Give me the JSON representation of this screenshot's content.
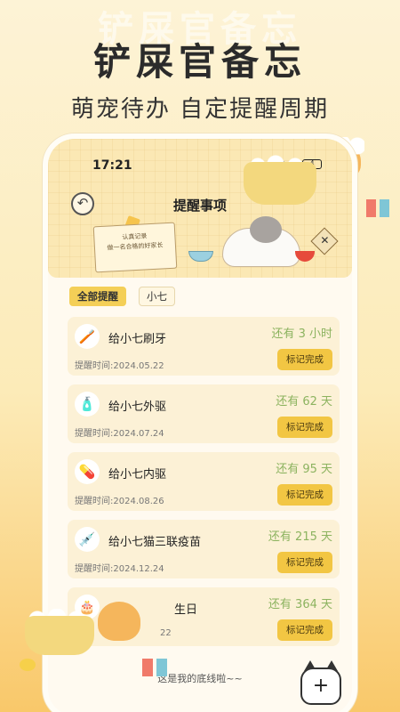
{
  "promo": {
    "headline": "铲屎官备忘",
    "ghost_text": "铲屎官备忘",
    "subtitle": "萌宠待办 自定提醒周期"
  },
  "status_bar": {
    "time": "17:21",
    "battery": "4"
  },
  "header": {
    "title": "提醒事项",
    "note_line1": "认真记录",
    "note_line2": "做一名合格的好家长"
  },
  "filters": [
    {
      "label": "全部提醒",
      "active": true
    },
    {
      "label": "小七",
      "active": false
    }
  ],
  "reminders": [
    {
      "title": "给小七刷牙",
      "date": "提醒时间:2024.05.22",
      "remaining": "还有 3 小时",
      "button": "标记完成",
      "icon": "toothbrush-icon"
    },
    {
      "title": "给小七外驱",
      "date": "提醒时间:2024.07.24",
      "remaining": "还有 62 天",
      "button": "标记完成",
      "icon": "spray-bottle-icon"
    },
    {
      "title": "给小七内驱",
      "date": "提醒时间:2024.08.26",
      "remaining": "还有 95 天",
      "button": "标记完成",
      "icon": "pill-icon"
    },
    {
      "title": "给小七猫三联疫苗",
      "date": "提醒时间:2024.12.24",
      "remaining": "还有 215 天",
      "button": "标记完成",
      "icon": "vaccine-icon"
    },
    {
      "title": "生日",
      "date": "22",
      "remaining": "还有 364 天",
      "button": "标记完成",
      "icon": "cake-icon"
    }
  ],
  "footer": {
    "text": "这是我的底线啦~~",
    "add_label": "+"
  }
}
